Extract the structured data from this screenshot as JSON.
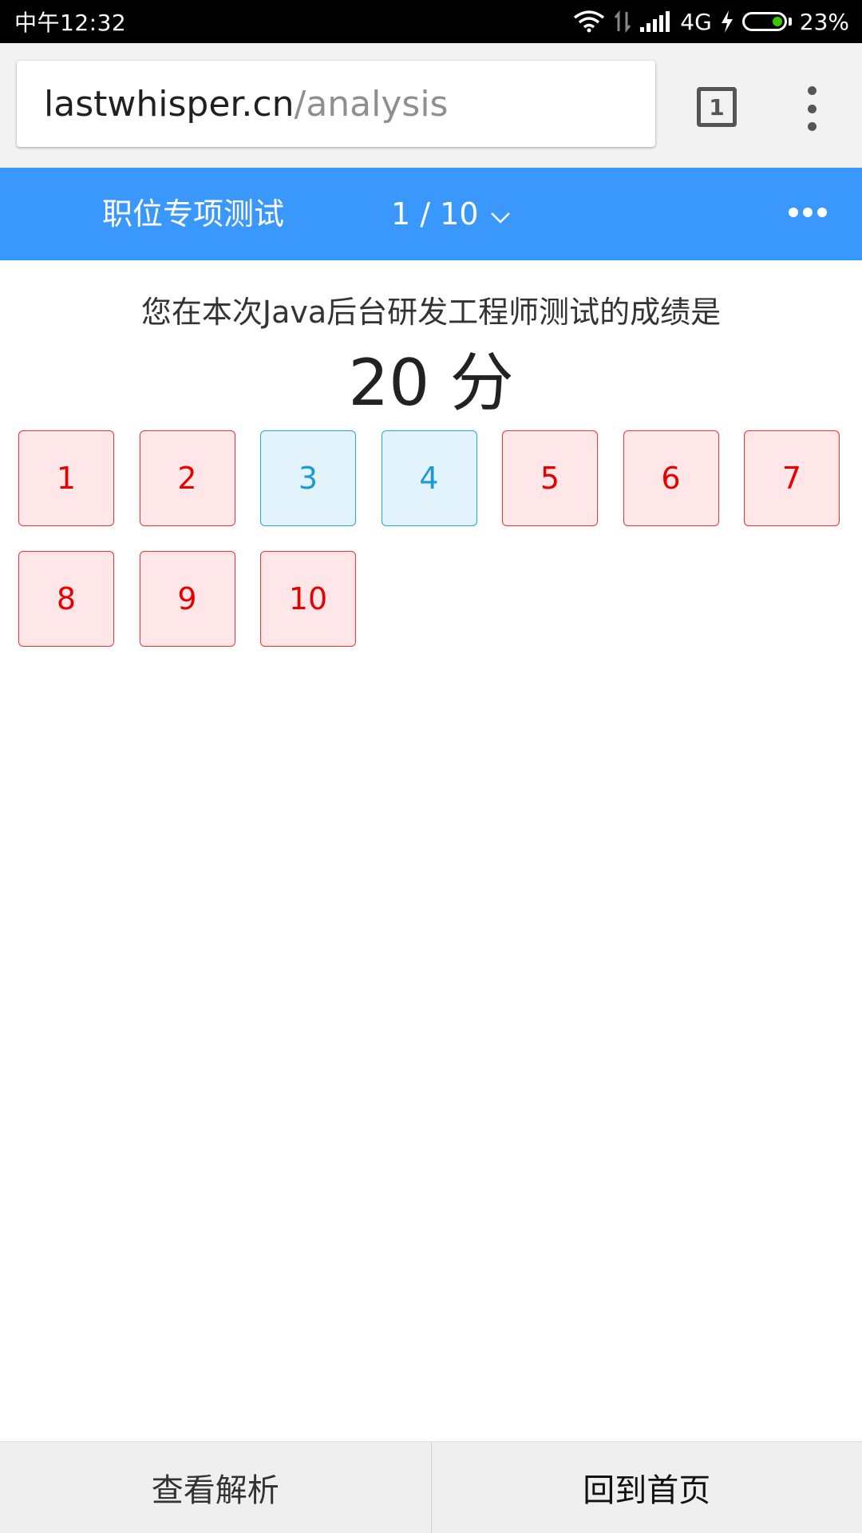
{
  "status_bar": {
    "time": "中午12:32",
    "network": "4G",
    "battery": "23%",
    "battery_level": 0.23,
    "icons": [
      "wifi-icon",
      "data-transfer-icon",
      "signal-icon",
      "charging-icon",
      "battery-icon"
    ]
  },
  "browser": {
    "url_host": "lastwhisper.cn",
    "url_path": "/analysis",
    "tab_count": "1"
  },
  "header": {
    "title": "职位专项测试",
    "page_indicator": "1 / 10",
    "more_icon": "more-horizontal-icon"
  },
  "result": {
    "caption": "您在本次Java后台研发工程师测试的成绩是",
    "score": "20 分"
  },
  "questions": [
    {
      "label": "1",
      "status": "wrong"
    },
    {
      "label": "2",
      "status": "wrong"
    },
    {
      "label": "3",
      "status": "correct"
    },
    {
      "label": "4",
      "status": "correct"
    },
    {
      "label": "5",
      "status": "wrong"
    },
    {
      "label": "6",
      "status": "wrong"
    },
    {
      "label": "7",
      "status": "wrong"
    },
    {
      "label": "8",
      "status": "wrong"
    },
    {
      "label": "9",
      "status": "wrong"
    },
    {
      "label": "10",
      "status": "wrong"
    }
  ],
  "colors": {
    "header_bg": "#3a98fc",
    "wrong_border": "#ff2f2f",
    "wrong_bg": "#ffe6e8",
    "wrong_text": "#e60000",
    "correct_border": "#24a6df",
    "correct_bg": "#e2f3fb",
    "correct_text": "#1a9ad6"
  },
  "bottom_bar": {
    "view_analysis": "查看解析",
    "back_home": "回到首页"
  }
}
